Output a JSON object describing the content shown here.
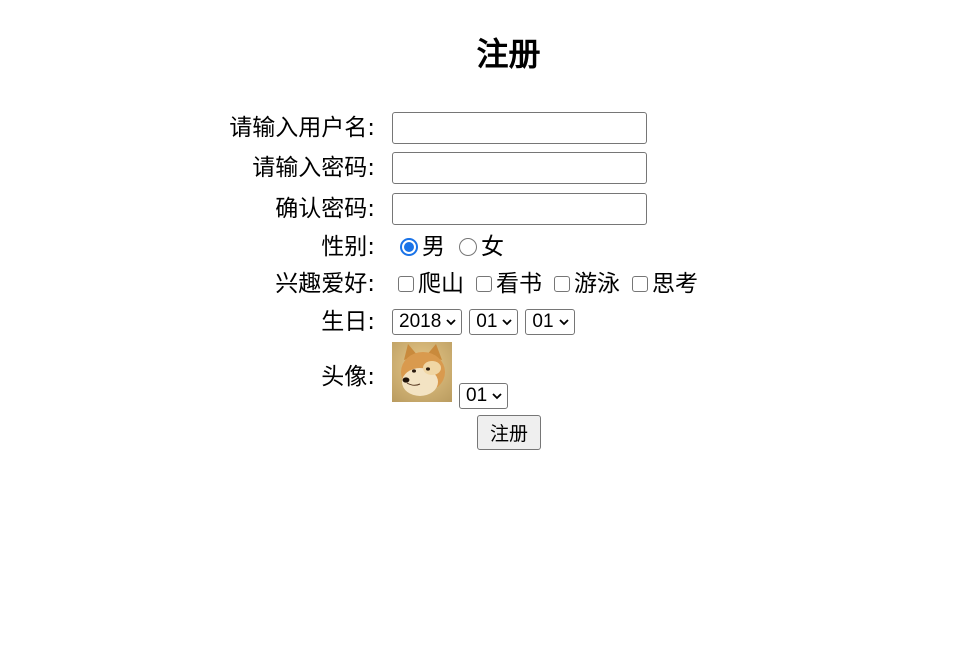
{
  "title": "注册",
  "form": {
    "username_label": "请输入用户名:",
    "username_value": "",
    "password_label": "请输入密码:",
    "password_value": "",
    "confirm_label": "确认密码:",
    "confirm_value": "",
    "gender_label": "性别:",
    "gender_options": [
      "男",
      "女"
    ],
    "gender_selected": "男",
    "hobby_label": "兴趣爱好:",
    "hobbies": [
      "爬山",
      "看书",
      "游泳",
      "思考"
    ],
    "birthday_label": "生日:",
    "birthday": {
      "year": "2018",
      "month": "01",
      "day": "01"
    },
    "avatar_label": "头像:",
    "avatar_select": "01",
    "submit_label": "注册"
  },
  "colors": {
    "accent": "#1a73e8",
    "border": "#767676",
    "button_bg": "#efefef"
  }
}
